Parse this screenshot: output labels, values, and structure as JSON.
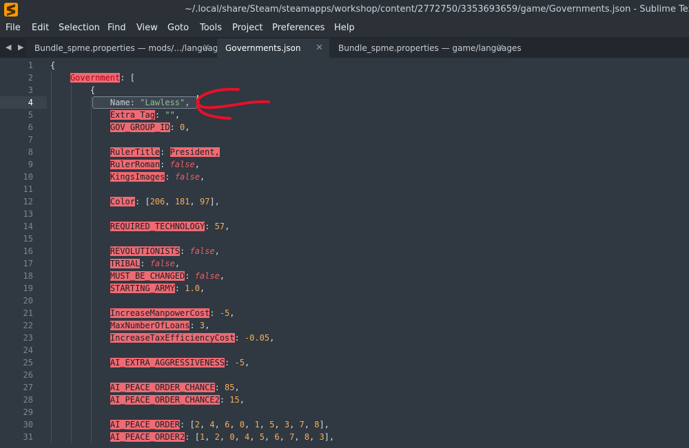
{
  "window": {
    "title": "~/.local/share/Steam/steamapps/workshop/content/2772750/3353693659/game/Governments.json - Sublime Text (UNREGISTERED)"
  },
  "menu": [
    "File",
    "Edit",
    "Selection",
    "Find",
    "View",
    "Goto",
    "Tools",
    "Project",
    "Preferences",
    "Help"
  ],
  "tab_nav": "◀ ▶",
  "tabs": [
    {
      "label": "Bundle_spme.properties — mods/.../languages",
      "close": "✕"
    },
    {
      "label": "Governments.json",
      "close": "✕",
      "active": true
    },
    {
      "label": "Bundle_spme.properties — game/languages",
      "close": "✕"
    }
  ],
  "editor": {
    "line_numbers": [
      "1",
      "2",
      "3",
      "4",
      "5",
      "6",
      "7",
      "8",
      "9",
      "10",
      "11",
      "12",
      "13",
      "14",
      "15",
      "16",
      "17",
      "18",
      "19",
      "20",
      "21",
      "22",
      "23",
      "24",
      "25",
      "26",
      "27",
      "28",
      "29",
      "30",
      "31"
    ],
    "current_line": "4",
    "lines": [
      {
        "parts": [
          {
            "t": "{",
            "c": "punc"
          }
        ]
      },
      {
        "parts": [
          {
            "t": "Government",
            "c": "key-dark"
          },
          {
            "t": ": [",
            "c": "punc"
          }
        ]
      },
      {
        "parts": [
          {
            "t": "{",
            "c": "punc"
          }
        ]
      },
      {
        "parts": [
          {
            "t": "Name",
            "c": "punc"
          },
          {
            "t": ": ",
            "c": "punc"
          },
          {
            "t": "\"Lawless\"",
            "c": "str"
          },
          {
            "t": ",",
            "c": "punc"
          }
        ]
      },
      {
        "parts": [
          {
            "t": "Extra_Tag",
            "c": "key"
          },
          {
            "t": ": ",
            "c": "punc"
          },
          {
            "t": "\"\"",
            "c": "str"
          },
          {
            "t": ",",
            "c": "punc"
          }
        ]
      },
      {
        "parts": [
          {
            "t": "GOV_GROUP_ID",
            "c": "key"
          },
          {
            "t": ": ",
            "c": "punc"
          },
          {
            "t": "0",
            "c": "num"
          },
          {
            "t": ",",
            "c": "punc"
          }
        ]
      },
      {
        "parts": []
      },
      {
        "parts": [
          {
            "t": "RulerTitle",
            "c": "key"
          },
          {
            "t": ": ",
            "c": "punc"
          },
          {
            "t": "President,",
            "c": "key"
          }
        ]
      },
      {
        "parts": [
          {
            "t": "RulerRoman",
            "c": "key"
          },
          {
            "t": ": ",
            "c": "punc"
          },
          {
            "t": "false",
            "c": "bool"
          },
          {
            "t": ",",
            "c": "punc"
          }
        ]
      },
      {
        "parts": [
          {
            "t": "KingsImages",
            "c": "key"
          },
          {
            "t": ": ",
            "c": "punc"
          },
          {
            "t": "false",
            "c": "bool"
          },
          {
            "t": ",",
            "c": "punc"
          }
        ]
      },
      {
        "parts": []
      },
      {
        "parts": [
          {
            "t": "Color",
            "c": "key"
          },
          {
            "t": ": [",
            "c": "punc"
          },
          {
            "t": "206",
            "c": "num"
          },
          {
            "t": ", ",
            "c": "punc"
          },
          {
            "t": "181",
            "c": "num"
          },
          {
            "t": ", ",
            "c": "punc"
          },
          {
            "t": "97",
            "c": "num"
          },
          {
            "t": "],",
            "c": "punc"
          }
        ]
      },
      {
        "parts": []
      },
      {
        "parts": [
          {
            "t": "REQUIRED_TECHNOLOGY",
            "c": "key"
          },
          {
            "t": ": ",
            "c": "punc"
          },
          {
            "t": "57",
            "c": "num"
          },
          {
            "t": ",",
            "c": "punc"
          }
        ]
      },
      {
        "parts": []
      },
      {
        "parts": [
          {
            "t": "REVOLUTIONISTS",
            "c": "key"
          },
          {
            "t": ": ",
            "c": "punc"
          },
          {
            "t": "false",
            "c": "bool"
          },
          {
            "t": ",",
            "c": "punc"
          }
        ]
      },
      {
        "parts": [
          {
            "t": "TRIBAL",
            "c": "key"
          },
          {
            "t": ": ",
            "c": "punc"
          },
          {
            "t": "false",
            "c": "bool"
          },
          {
            "t": ",",
            "c": "punc"
          }
        ]
      },
      {
        "parts": [
          {
            "t": "MUST_BE_CHANGED",
            "c": "key"
          },
          {
            "t": ": ",
            "c": "punc"
          },
          {
            "t": "false",
            "c": "bool"
          },
          {
            "t": ",",
            "c": "punc"
          }
        ]
      },
      {
        "parts": [
          {
            "t": "STARTING_ARMY",
            "c": "key"
          },
          {
            "t": ": ",
            "c": "punc"
          },
          {
            "t": "1.0",
            "c": "num"
          },
          {
            "t": ",",
            "c": "punc"
          }
        ]
      },
      {
        "parts": []
      },
      {
        "parts": [
          {
            "t": "IncreaseManpowerCost",
            "c": "key"
          },
          {
            "t": ": ",
            "c": "punc"
          },
          {
            "t": "-5",
            "c": "num"
          },
          {
            "t": ",",
            "c": "punc"
          }
        ]
      },
      {
        "parts": [
          {
            "t": "MaxNumberOfLoans",
            "c": "key"
          },
          {
            "t": ": ",
            "c": "punc"
          },
          {
            "t": "3",
            "c": "num"
          },
          {
            "t": ",",
            "c": "punc"
          }
        ]
      },
      {
        "parts": [
          {
            "t": "IncreaseTaxEfficiencyCost",
            "c": "key"
          },
          {
            "t": ": ",
            "c": "punc"
          },
          {
            "t": "-0.05",
            "c": "num"
          },
          {
            "t": ",",
            "c": "punc"
          }
        ]
      },
      {
        "parts": []
      },
      {
        "parts": [
          {
            "t": "AI_EXTRA_AGGRESSIVENESS",
            "c": "key"
          },
          {
            "t": ": ",
            "c": "punc"
          },
          {
            "t": "-5",
            "c": "num"
          },
          {
            "t": ",",
            "c": "punc"
          }
        ]
      },
      {
        "parts": []
      },
      {
        "parts": [
          {
            "t": "AI_PEACE_ORDER_CHANCE",
            "c": "key"
          },
          {
            "t": ": ",
            "c": "punc"
          },
          {
            "t": "85",
            "c": "num"
          },
          {
            "t": ",",
            "c": "punc"
          }
        ]
      },
      {
        "parts": [
          {
            "t": "AI_PEACE_ORDER_CHANCE2",
            "c": "key"
          },
          {
            "t": ": ",
            "c": "punc"
          },
          {
            "t": "15",
            "c": "num"
          },
          {
            "t": ",",
            "c": "punc"
          }
        ]
      },
      {
        "parts": []
      },
      {
        "parts": [
          {
            "t": "AI_PEACE_ORDER",
            "c": "key"
          },
          {
            "t": ": [",
            "c": "punc"
          },
          {
            "t": "2",
            "c": "num"
          },
          {
            "t": ", ",
            "c": "punc"
          },
          {
            "t": "4",
            "c": "num"
          },
          {
            "t": ", ",
            "c": "punc"
          },
          {
            "t": "6",
            "c": "num"
          },
          {
            "t": ", ",
            "c": "punc"
          },
          {
            "t": "0",
            "c": "num"
          },
          {
            "t": ", ",
            "c": "punc"
          },
          {
            "t": "1",
            "c": "num"
          },
          {
            "t": ", ",
            "c": "punc"
          },
          {
            "t": "5",
            "c": "num"
          },
          {
            "t": ", ",
            "c": "punc"
          },
          {
            "t": "3",
            "c": "num"
          },
          {
            "t": ", ",
            "c": "punc"
          },
          {
            "t": "7",
            "c": "num"
          },
          {
            "t": ", ",
            "c": "punc"
          },
          {
            "t": "8",
            "c": "num"
          },
          {
            "t": "],",
            "c": "punc"
          }
        ]
      },
      {
        "parts": [
          {
            "t": "AI_PEACE_ORDER2",
            "c": "key"
          },
          {
            "t": ": [",
            "c": "punc"
          },
          {
            "t": "1",
            "c": "num"
          },
          {
            "t": ", ",
            "c": "punc"
          },
          {
            "t": "2",
            "c": "num"
          },
          {
            "t": ", ",
            "c": "punc"
          },
          {
            "t": "0",
            "c": "num"
          },
          {
            "t": ", ",
            "c": "punc"
          },
          {
            "t": "4",
            "c": "num"
          },
          {
            "t": ", ",
            "c": "punc"
          },
          {
            "t": "5",
            "c": "num"
          },
          {
            "t": ", ",
            "c": "punc"
          },
          {
            "t": "6",
            "c": "num"
          },
          {
            "t": ", ",
            "c": "punc"
          },
          {
            "t": "7",
            "c": "num"
          },
          {
            "t": ", ",
            "c": "punc"
          },
          {
            "t": "8",
            "c": "num"
          },
          {
            "t": ", ",
            "c": "punc"
          },
          {
            "t": "3",
            "c": "num"
          },
          {
            "t": "],",
            "c": "punc"
          }
        ]
      }
    ]
  },
  "colors": {
    "background": "#303841",
    "key_highlight": "#ef6a73",
    "string": "#99c794",
    "number": "#f9ae58",
    "boolean": "#ec5f66",
    "annotation": "#e8102a"
  }
}
